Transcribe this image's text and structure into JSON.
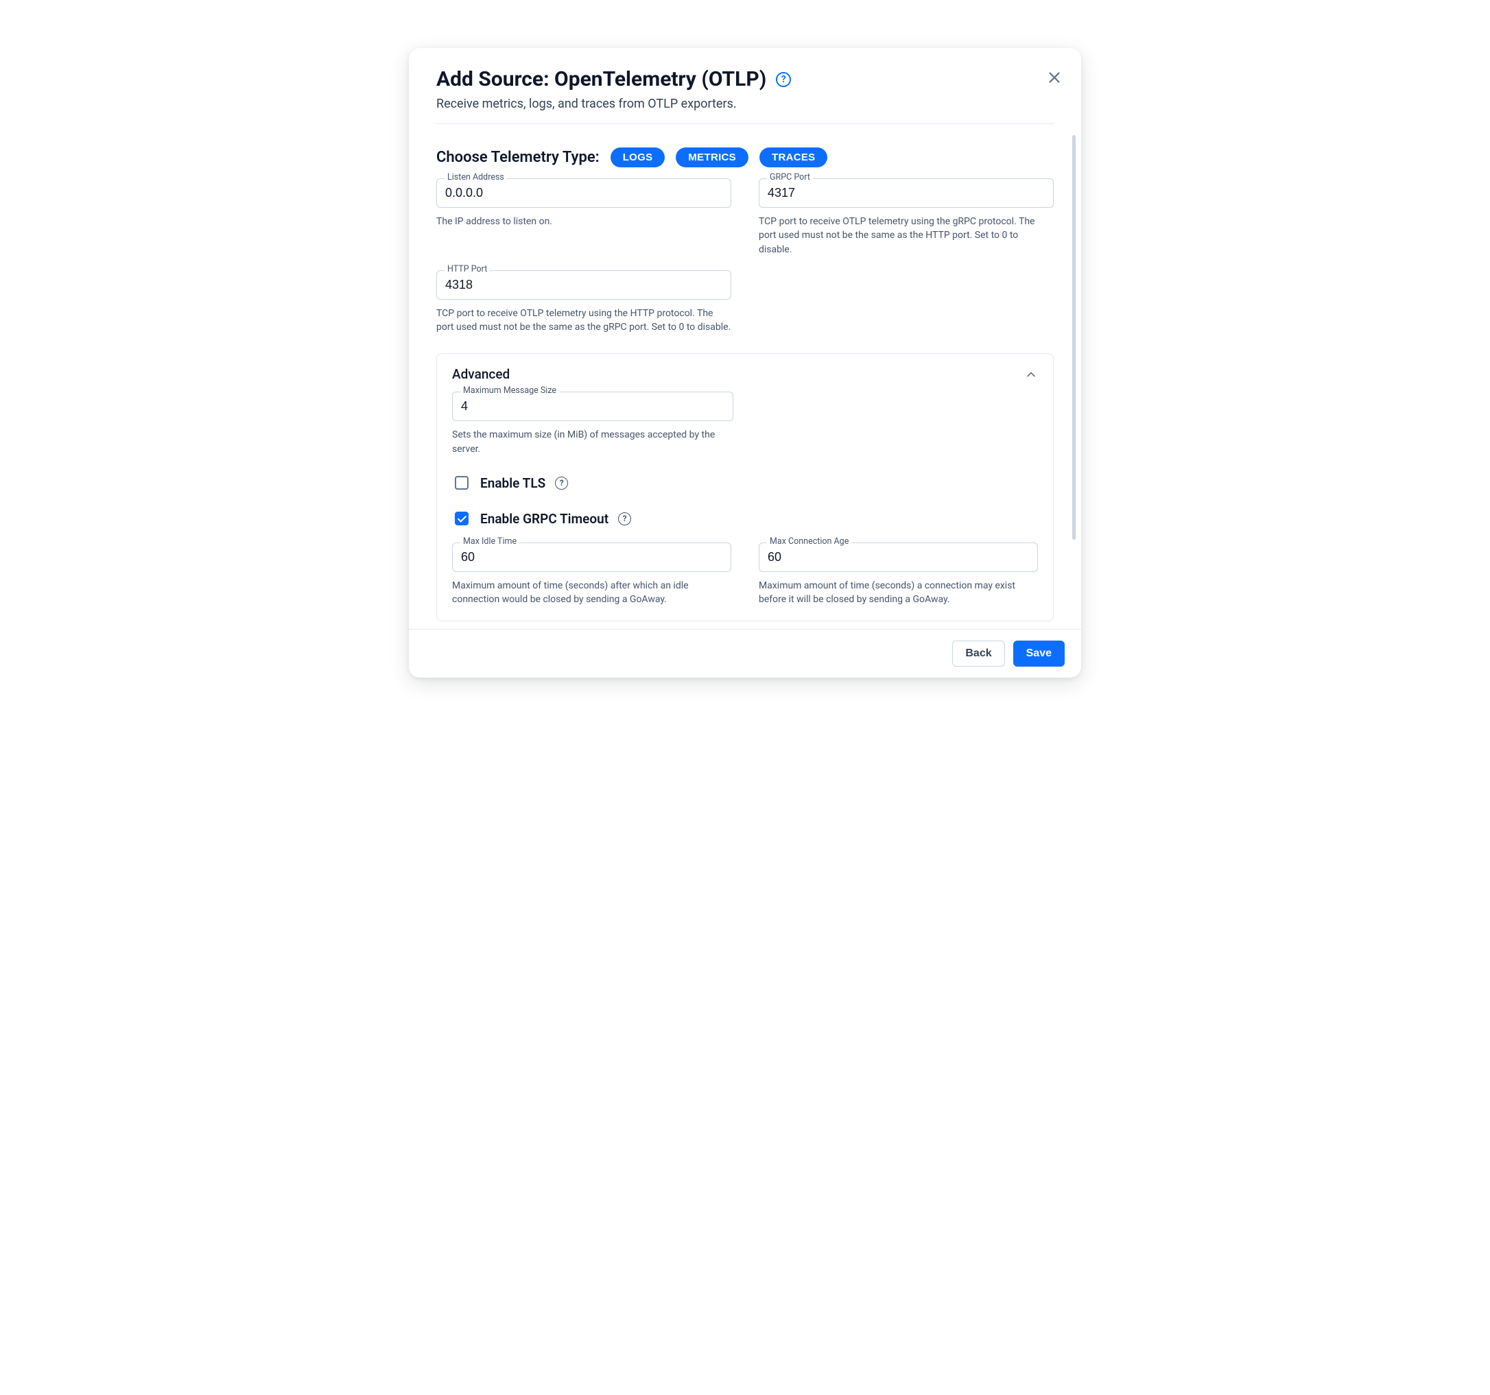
{
  "header": {
    "title": "Add Source: OpenTelemetry (OTLP)",
    "subtitle": "Receive metrics, logs, and traces from OTLP exporters."
  },
  "telemetry": {
    "label": "Choose Telemetry Type:",
    "types": {
      "logs": "LOGS",
      "metrics": "METRICS",
      "traces": "TRACES"
    }
  },
  "fields": {
    "listen_address": {
      "label": "Listen Address",
      "value": "0.0.0.0",
      "help": "The IP address to listen on."
    },
    "grpc_port": {
      "label": "GRPC Port",
      "value": "4317",
      "help": "TCP port to receive OTLP telemetry using the gRPC protocol. The port used must not be the same as the HTTP port. Set to 0 to disable."
    },
    "http_port": {
      "label": "HTTP Port",
      "value": "4318",
      "help": "TCP port to receive OTLP telemetry using the HTTP protocol. The port used must not be the same as the gRPC port. Set to 0 to disable."
    }
  },
  "advanced": {
    "title": "Advanced",
    "max_msg_size": {
      "label": "Maximum Message Size",
      "value": "4",
      "help": "Sets the maximum size (in MiB) of messages accepted by the server."
    },
    "enable_tls": {
      "label": "Enable TLS",
      "checked": false
    },
    "enable_grpc_timeout": {
      "label": "Enable GRPC Timeout",
      "checked": true
    },
    "max_idle_time": {
      "label": "Max Idle Time",
      "value": "60",
      "help": "Maximum amount of time (seconds) after which an idle connection would be closed by sending a GoAway."
    },
    "max_conn_age": {
      "label": "Max Connection Age",
      "value": "60",
      "help": "Maximum amount of time (seconds) a connection may exist before it will be closed by sending a GoAway."
    }
  },
  "footer": {
    "back": "Back",
    "save": "Save"
  }
}
